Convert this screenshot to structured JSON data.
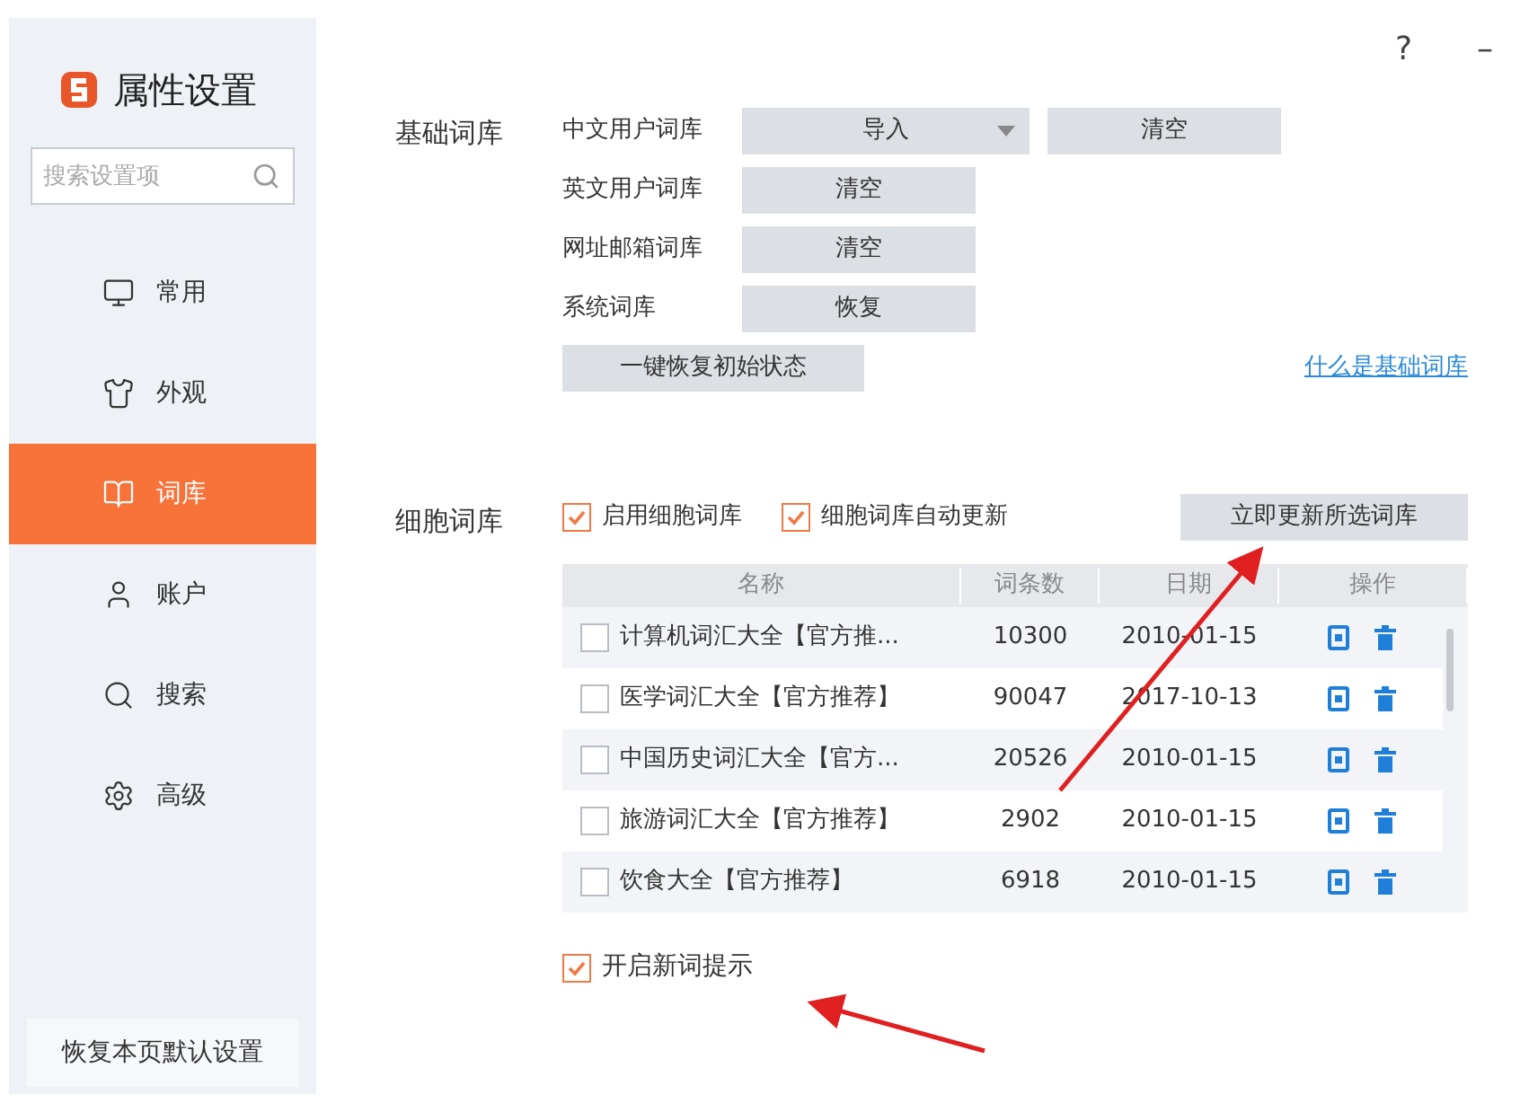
{
  "sidebar": {
    "title": "属性设置",
    "search": {
      "placeholder": "搜索设置项"
    },
    "items": [
      {
        "label": "常用",
        "selected": false
      },
      {
        "label": "外观",
        "selected": false
      },
      {
        "label": "词库",
        "selected": true
      },
      {
        "label": "账户",
        "selected": false
      },
      {
        "label": "搜索",
        "selected": false
      },
      {
        "label": "高级",
        "selected": false
      }
    ],
    "reset_button": "恢复本页默认设置"
  },
  "window_controls": [
    "?",
    "–"
  ],
  "basic": {
    "title": "基础词库",
    "rows": [
      {
        "label": "中文用户词库",
        "buttons": [
          {
            "label": "导入",
            "kind": "dropdown"
          },
          {
            "label": "清空",
            "kind": "plain"
          }
        ]
      },
      {
        "label": "英文用户词库",
        "buttons": [
          {
            "label": "清空",
            "kind": "plain"
          }
        ]
      },
      {
        "label": "网址邮箱词库",
        "buttons": [
          {
            "label": "清空",
            "kind": "plain"
          }
        ]
      },
      {
        "label": "系统词库",
        "buttons": [
          {
            "label": "恢复",
            "kind": "plain"
          }
        ]
      }
    ],
    "restore_button": "一键恢复初始状态",
    "help_link": "什么是基础词库"
  },
  "cell": {
    "title": "细胞词库",
    "options": [
      {
        "label": "启用细胞词库",
        "checked": true
      },
      {
        "label": "细胞词库自动更新",
        "checked": true
      }
    ],
    "update_button": "立即更新所选词库",
    "table": {
      "columns": [
        "名称",
        "词条数",
        "日期",
        "操作"
      ],
      "rows": [
        {
          "name": "计算机词汇大全【官方推...",
          "count": "10300",
          "date": "2010-01-15",
          "checked": false
        },
        {
          "name": "医学词汇大全【官方推荐】",
          "count": "90047",
          "date": "2017-10-13",
          "checked": false
        },
        {
          "name": "中国历史词汇大全【官方...",
          "count": "20526",
          "date": "2010-01-15",
          "checked": false
        },
        {
          "name": "旅游词汇大全【官方推荐】",
          "count": "2902",
          "date": "2010-01-15",
          "checked": false
        },
        {
          "name": "饮食大全【官方推荐】",
          "count": "6918",
          "date": "2010-01-15",
          "checked": false
        }
      ]
    },
    "new_word_hint": {
      "label": "开启新词提示",
      "checked": true
    }
  }
}
